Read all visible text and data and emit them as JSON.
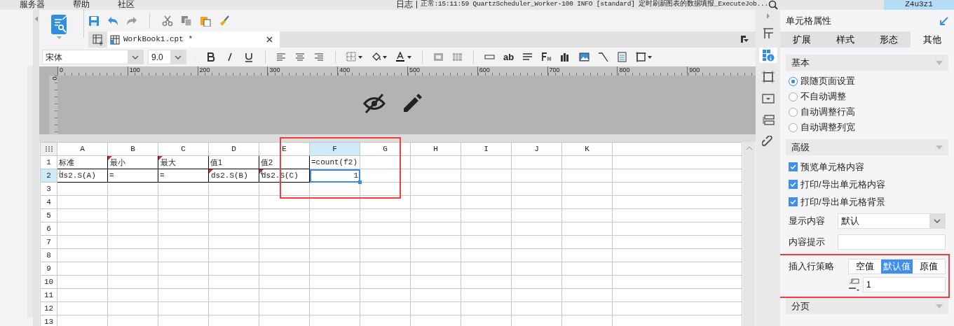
{
  "menu": [
    {
      "label": "服务器"
    },
    {
      "label": "帮助"
    },
    {
      "label": "社区"
    }
  ],
  "log": {
    "label": "日志",
    "message": "正常:15:11:59 QuartzScheduler_Worker-100 INFO [standard] 定时刷新图表的数据填报_ExecuteJob..."
  },
  "user": "Z4u3z1",
  "tab": {
    "title": "WorkBook1.cpt *"
  },
  "format": {
    "font": "宋体",
    "size": "9.0",
    "text_tool": "ab"
  },
  "ruler": {
    "ticks": [
      "0",
      "100",
      "200",
      "300",
      "400",
      "500",
      "600",
      "700",
      "800",
      "900"
    ],
    "side": "0"
  },
  "sheet": {
    "highlighted": true,
    "columns": [
      {
        "label": "A",
        "selected": false
      },
      {
        "label": "B",
        "selected": false
      },
      {
        "label": "C",
        "selected": false
      },
      {
        "label": "D",
        "selected": false
      },
      {
        "label": "E",
        "selected": false
      },
      {
        "label": "F",
        "selected": true
      },
      {
        "label": "G",
        "selected": false
      },
      {
        "label": "H",
        "selected": false
      },
      {
        "label": "I",
        "selected": false
      },
      {
        "label": "J",
        "selected": false
      },
      {
        "label": "K",
        "selected": false
      }
    ],
    "rows": [
      {
        "label": "1",
        "selected": false,
        "cells": [
          {
            "text": "标准",
            "bordered": true,
            "flagged": false,
            "expand": false,
            "selected": false
          },
          {
            "text": "最小",
            "bordered": true,
            "flagged": true,
            "expand": false,
            "selected": false
          },
          {
            "text": "最大",
            "bordered": true,
            "flagged": true,
            "expand": false,
            "selected": false
          },
          {
            "text": "值1",
            "bordered": true,
            "flagged": false,
            "expand": false,
            "selected": false
          },
          {
            "text": "值2",
            "bordered": true,
            "flagged": false,
            "expand": false,
            "selected": false
          },
          {
            "text": "=count(f2)",
            "bordered": false,
            "flagged": false,
            "expand": false,
            "selected": false
          }
        ]
      },
      {
        "label": "2",
        "selected": true,
        "cells": [
          {
            "text": "ds2.S(A)",
            "bordered": true,
            "flagged": false,
            "expand": true,
            "selected": false
          },
          {
            "text": "=",
            "bordered": true,
            "flagged": false,
            "expand": false,
            "selected": false
          },
          {
            "text": "=",
            "bordered": true,
            "flagged": false,
            "expand": false,
            "selected": false
          },
          {
            "text": "ds2.S(B)",
            "bordered": true,
            "flagged": true,
            "expand": false,
            "selected": false
          },
          {
            "text": "ds2.S(C)",
            "bordered": true,
            "flagged": true,
            "expand": true,
            "selected": false
          },
          {
            "text": "1",
            "bordered": false,
            "flagged": false,
            "expand": false,
            "selected": true
          }
        ]
      },
      {
        "label": "3",
        "selected": false
      },
      {
        "label": "4",
        "selected": false
      },
      {
        "label": "5",
        "selected": false
      },
      {
        "label": "6",
        "selected": false
      },
      {
        "label": "7",
        "selected": false
      },
      {
        "label": "8",
        "selected": false
      },
      {
        "label": "9",
        "selected": false
      },
      {
        "label": "10",
        "selected": false
      },
      {
        "label": "11",
        "selected": false
      },
      {
        "label": "12",
        "selected": false
      },
      {
        "label": "13",
        "selected": false
      }
    ]
  },
  "panel": {
    "title": "单元格属性",
    "tabs": [
      {
        "label": "扩展",
        "selected": false
      },
      {
        "label": "样式",
        "selected": false
      },
      {
        "label": "形态",
        "selected": false
      },
      {
        "label": "其他",
        "selected": true
      }
    ],
    "sections": [
      {
        "title": "基本",
        "items": [
          {
            "kind": "radio",
            "label": "跟随页面设置",
            "selected": true
          },
          {
            "kind": "radio",
            "label": "不自动调整",
            "selected": false
          },
          {
            "kind": "radio",
            "label": "自动调整行高",
            "selected": false
          },
          {
            "kind": "radio",
            "label": "自动调整列宽",
            "selected": false
          }
        ]
      },
      {
        "title": "高级",
        "items": [
          {
            "kind": "checkbox",
            "label": "预览单元格内容",
            "checked": true
          },
          {
            "kind": "checkbox",
            "label": "打印/导出单元格内容",
            "checked": true
          },
          {
            "kind": "checkbox",
            "label": "打印/导出单元格背景",
            "checked": true
          },
          {
            "kind": "select",
            "label": "显示内容",
            "value": "默认"
          },
          {
            "kind": "text",
            "label": "内容提示"
          },
          {
            "kind": "segmented",
            "label": "插入行策略",
            "highlighted": true,
            "value": "1",
            "options": [
              {
                "label": "空值",
                "selected": false
              },
              {
                "label": "默认值",
                "selected": true
              },
              {
                "label": "原值",
                "selected": false
              }
            ]
          }
        ]
      },
      {
        "title": "分页"
      }
    ]
  }
}
